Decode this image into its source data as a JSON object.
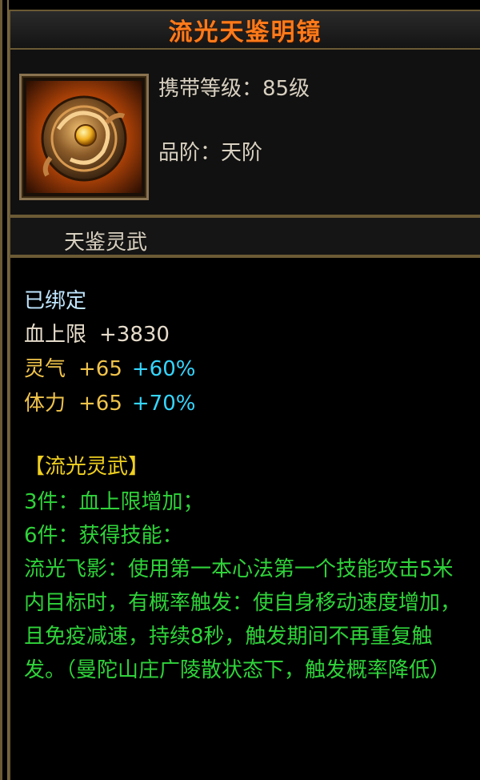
{
  "item": {
    "title": "流光天鉴明镜",
    "level_label": "携带等级：85级",
    "grade_label": "品阶：天阶",
    "set_name": "天鉴灵武",
    "bound": "已绑定",
    "hp_label": "血上限",
    "hp_value": "+3830",
    "stats": [
      {
        "name": "灵气",
        "value": "+65",
        "percent": "+60%"
      },
      {
        "name": "体力",
        "value": "+65",
        "percent": "+70%"
      }
    ],
    "set_bonus_title": "【流光灵武】",
    "set_3": "3件：血上限增加；",
    "set_6": "6件：获得技能：",
    "skill_desc": "流光飞影：使用第一本心法第一个技能攻击5米内目标时，有概率触发：使自身移动速度增加，且免疫减速，持续8秒，触发期间不再重复触发。（曼陀山庄广陵散状态下，触发概率降低）"
  },
  "colors": {
    "title": "#ff7a1a",
    "border": "#6b5a35",
    "bound": "#bfe6ff",
    "stat": "#f0c34a",
    "percent": "#35d6ff",
    "set_title": "#f0d020",
    "set_text": "#2fd33a"
  },
  "icons": [
    "bronze-mirror-icon"
  ]
}
